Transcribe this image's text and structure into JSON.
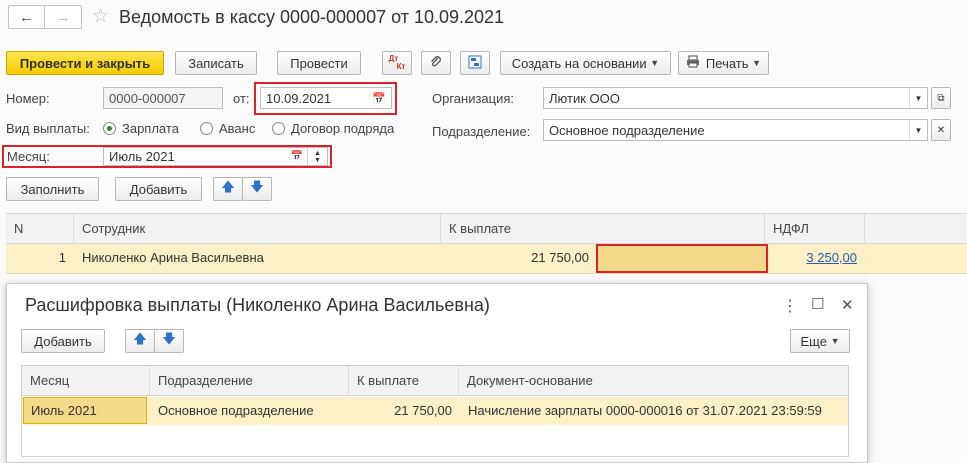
{
  "header": {
    "title": "Ведомость в кассу 0000-000007 от 10.09.2021",
    "back_glyph": "←",
    "forward_glyph": "→",
    "star_glyph": "☆"
  },
  "toolbar": {
    "post_close_label": "Провести и закрыть",
    "save_label": "Записать",
    "post_label": "Провести",
    "dtkt_top": "Дт",
    "dtkt_bottom": "Кт",
    "create_based_label": "Создать на основании",
    "print_label": "Печать"
  },
  "form": {
    "number_label": "Номер:",
    "number_value": "0000-000007",
    "date_label": "от:",
    "date_value": "10.09.2021",
    "organization_label": "Организация:",
    "organization_value": "Лютик ООО",
    "payment_type_label": "Вид выплаты:",
    "payment_types": [
      "Зарплата",
      "Аванс",
      "Договор подряда"
    ],
    "subdivision_label": "Подразделение:",
    "subdivision_value": "Основное подразделение",
    "month_label": "Месяц:",
    "month_value": "Июль 2021"
  },
  "table_toolbar": {
    "fill_label": "Заполнить",
    "add_label": "Добавить"
  },
  "main_table": {
    "columns": [
      "N",
      "Сотрудник",
      "К выплате",
      "",
      "НДФЛ"
    ],
    "rows": [
      {
        "n": "1",
        "employee": "Николенко Арина Васильевна",
        "amount": "21 750,00",
        "extra": "",
        "ndfl": "3 250,00"
      }
    ]
  },
  "popup": {
    "title": "Расшифровка выплаты (Николенко Арина Васильевна)",
    "menu_glyph": "⋮",
    "maximize_glyph": "☐",
    "close_glyph": "✕",
    "add_label": "Добавить",
    "more_label": "Еще",
    "columns": [
      "Месяц",
      "Подразделение",
      "К выплате",
      "Документ-основание"
    ],
    "rows": [
      {
        "month": "Июль 2021",
        "subdivision": "Основное подразделение",
        "amount": "21 750,00",
        "document": "Начисление зарплаты 0000-000016 от 31.07.2021 23:59:59"
      }
    ]
  },
  "colors": {
    "accent_yellow": "#f5cc00",
    "highlight_row": "#fbf0c6",
    "red_frame": "#d8232a",
    "link_blue": "#2a5fb3"
  }
}
